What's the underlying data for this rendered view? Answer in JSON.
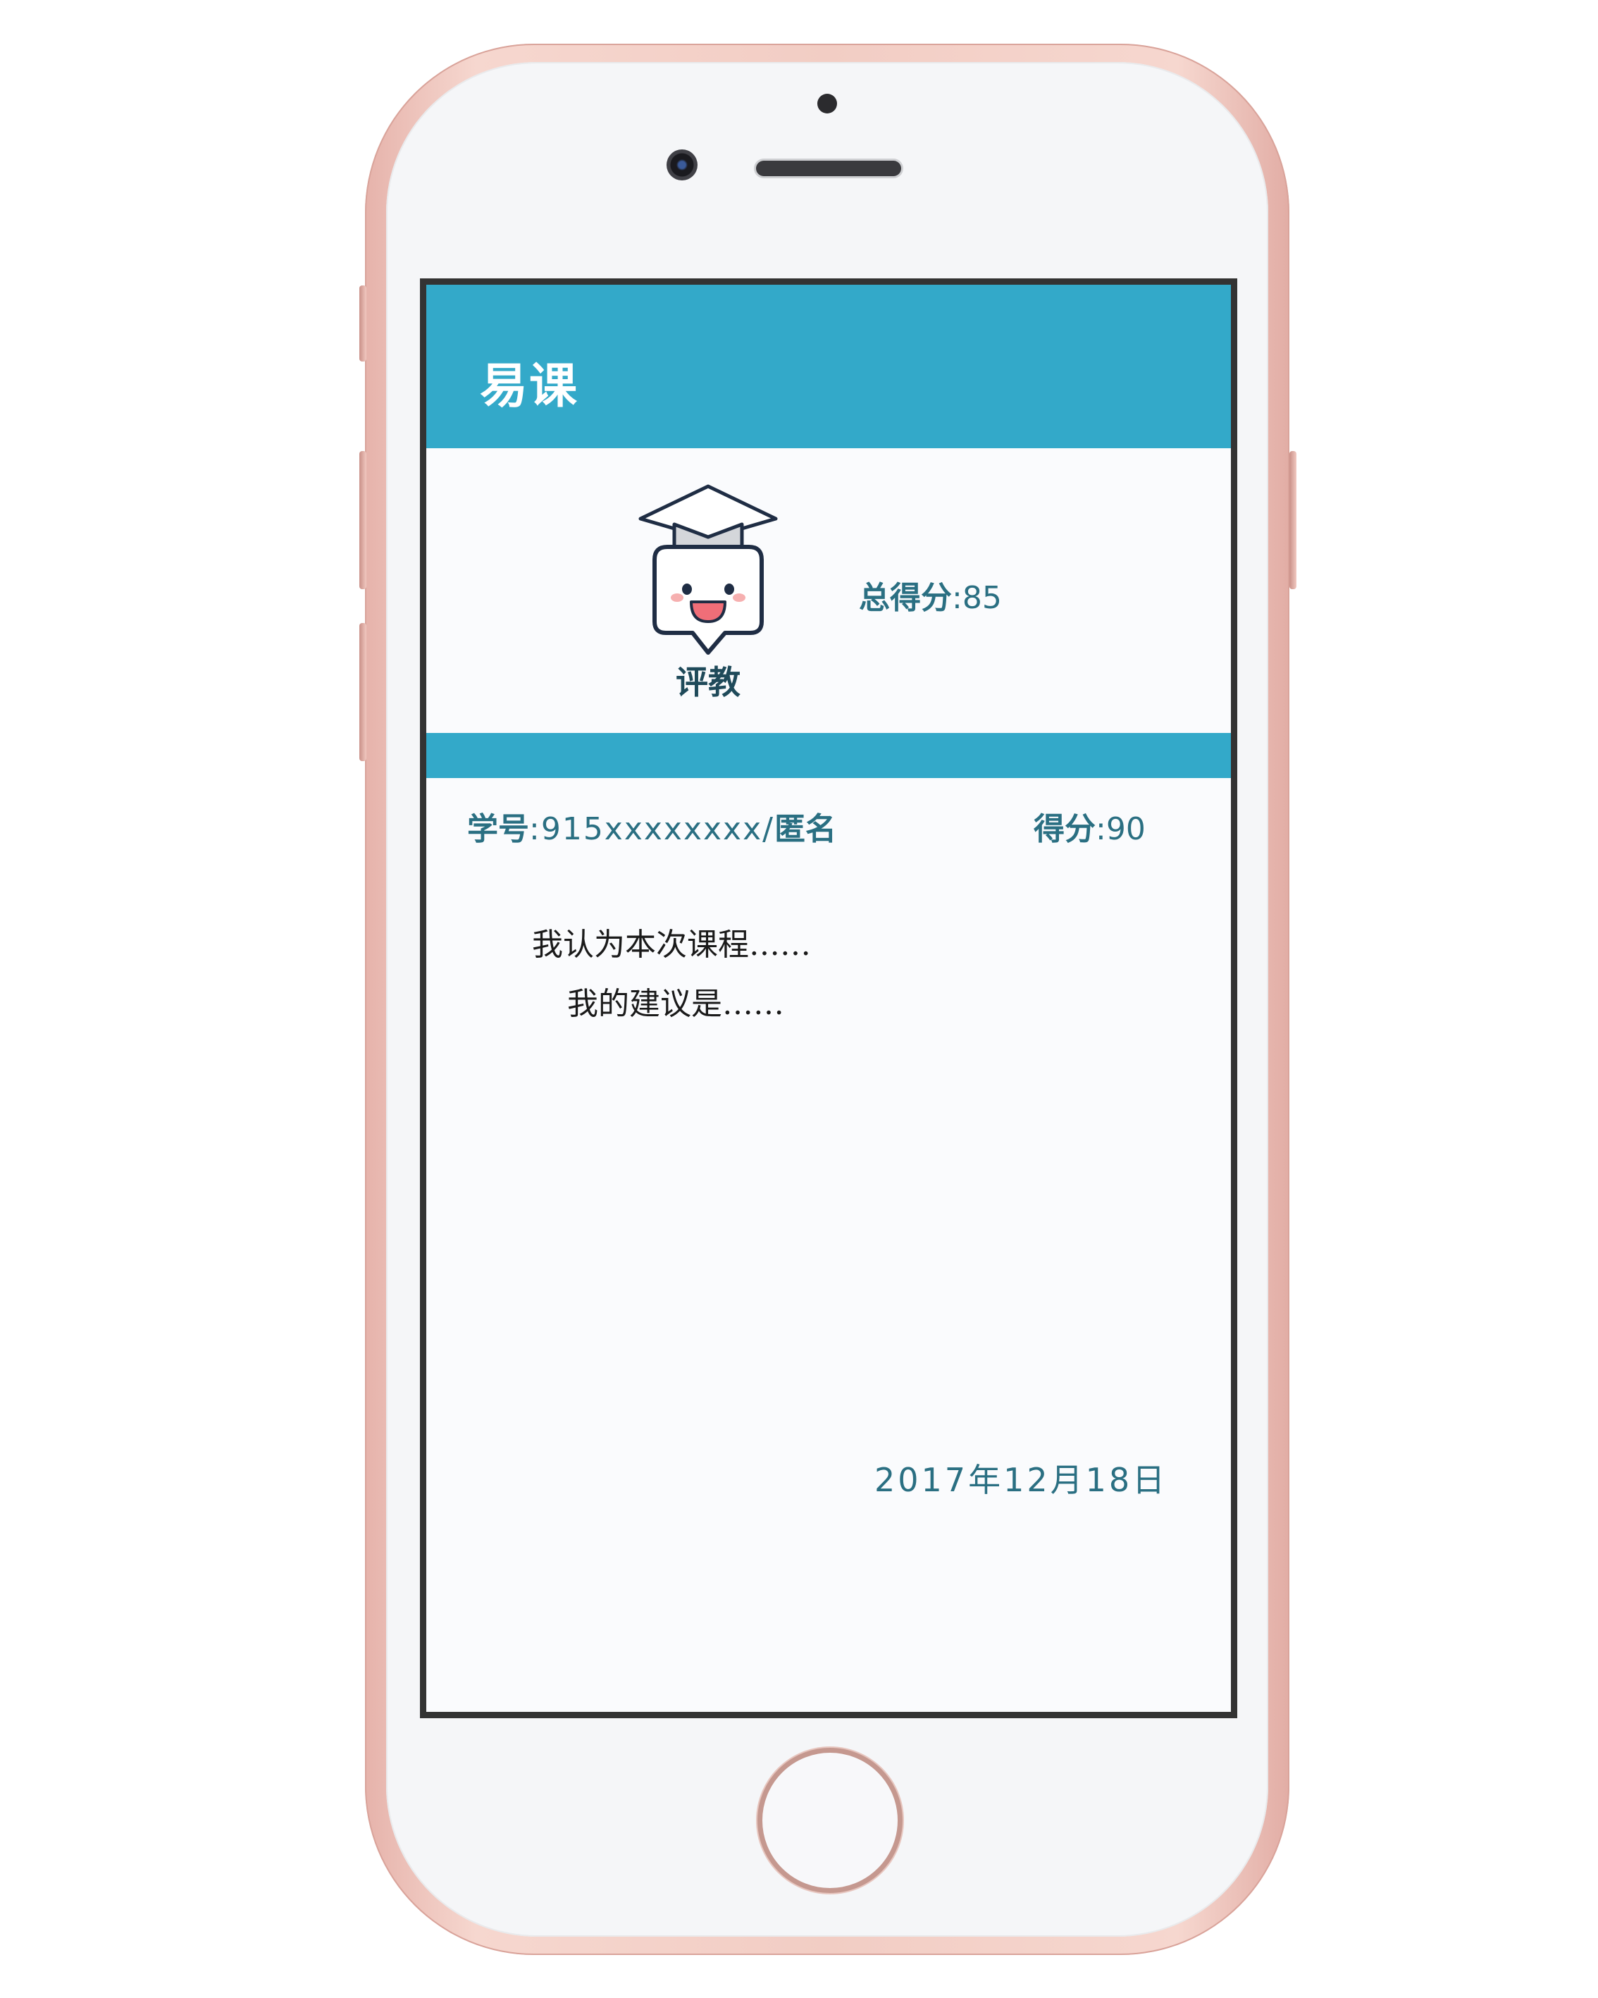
{
  "app": {
    "title": "易课"
  },
  "summary": {
    "mascot_label": "评教",
    "total_score_label": "总得分",
    "total_score_value": ":85"
  },
  "entry": {
    "student_label": "学号",
    "student_value": ":915xxxxxxxx/",
    "anonymous_label": "匿名",
    "score_label": "得分",
    "score_value": ":90",
    "comment_lines": [
      "我认为本次课程……",
      "我的建议是……"
    ],
    "date": "2017年12月18日"
  },
  "colors": {
    "header": "#33a9c9",
    "text_accent": "#2a6f82",
    "phone_frame": "#f2cdc4",
    "screen_border": "#333333"
  },
  "icons": {
    "mascot": "graduation-cap-chat-bubble-icon"
  }
}
